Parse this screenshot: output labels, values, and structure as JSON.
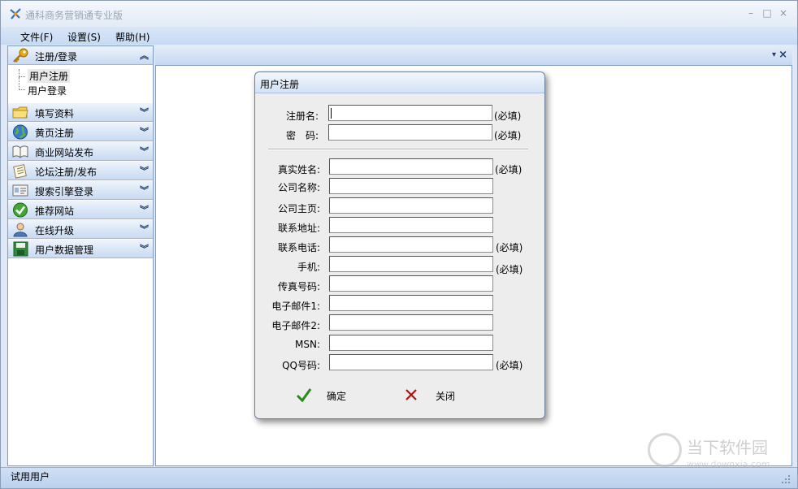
{
  "window": {
    "title": "通科商务营销通专业版",
    "controls": {
      "minimize": "–",
      "maximize": "□",
      "close": "×"
    }
  },
  "menu": {
    "items": [
      "文件(F)",
      "设置(S)",
      "帮助(H)"
    ]
  },
  "sidebar": {
    "sections": [
      {
        "label": "注册/登录",
        "icon": "key-icon",
        "chevron": "︽"
      },
      {
        "label": "填写资料",
        "icon": "folder-icon",
        "chevron": "︾"
      },
      {
        "label": "黄页注册",
        "icon": "globe-icon",
        "chevron": "︾"
      },
      {
        "label": "商业网站发布",
        "icon": "book-icon",
        "chevron": "︾"
      },
      {
        "label": "论坛注册/发布",
        "icon": "notes-icon",
        "chevron": "︾"
      },
      {
        "label": "搜索引擎登录",
        "icon": "card-icon",
        "chevron": "︾"
      },
      {
        "label": "推荐网站",
        "icon": "check-icon",
        "chevron": "︾"
      },
      {
        "label": "在线升级",
        "icon": "user-icon",
        "chevron": "︾"
      },
      {
        "label": "用户数据管理",
        "icon": "floppy-icon",
        "chevron": "︾"
      }
    ],
    "tree_items": [
      "用户注册",
      "用户登录"
    ]
  },
  "tabstrip": {
    "dropdown": "▾",
    "close": "×"
  },
  "dialog": {
    "title": "用户注册",
    "account_fields": [
      {
        "label": "注册名:",
        "value": "",
        "required": "(必填)"
      },
      {
        "label": "密　码:",
        "value": "",
        "required": "(必填)"
      }
    ],
    "profile_fields": [
      {
        "label": "真实姓名:",
        "value": "",
        "required": "(必填)"
      },
      {
        "label": "公司名称:",
        "value": "",
        "required": ""
      },
      {
        "label": "公司主页:",
        "value": "",
        "required": ""
      },
      {
        "label": "联系地址:",
        "value": "",
        "required": ""
      },
      {
        "label": "联系电话:",
        "value": "",
        "required": "(必填)"
      },
      {
        "label": "手机:",
        "value": "",
        "required": "(必填)"
      },
      {
        "label": "传真号码:",
        "value": "",
        "required": ""
      },
      {
        "label": "电子邮件1:",
        "value": "",
        "required": ""
      },
      {
        "label": "电子邮件2:",
        "value": "",
        "required": ""
      },
      {
        "label": "MSN:",
        "value": "",
        "required": ""
      },
      {
        "label": "QQ号码:",
        "value": "",
        "required": "(必填)"
      }
    ],
    "ok_label": "确定",
    "close_label": "关闭"
  },
  "statusbar": {
    "text": "试用用户"
  },
  "watermark": {
    "title": "当下软件园",
    "url": "www.downxia.com"
  },
  "colors": {
    "accent": "#c9daf2",
    "ok_green": "#2a8a1a",
    "close_red": "#b01010"
  }
}
